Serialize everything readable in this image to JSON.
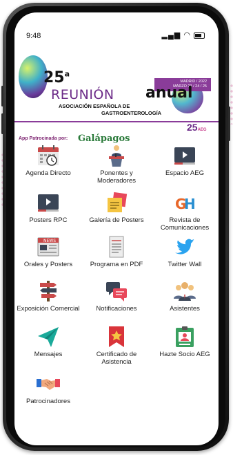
{
  "status": {
    "time": "9:48"
  },
  "banner": {
    "edition": "25",
    "edition_sup": "a",
    "title_word1": "REUNIÓN",
    "title_word2": "anual",
    "dates_line1": "MADRID / 2022",
    "dates_line2": "MARZO 23 / 24 / 25",
    "assoc_line1": "ASOCIACIÓN ESPAÑOLA DE",
    "assoc_line2": "GASTROENTEROLOGÍA",
    "sponsor_prefix": "App Patrocinada por:",
    "sponsor_name": "Galápagos",
    "aeg_number": "25",
    "aeg_mark": "AEG"
  },
  "menu": [
    {
      "label": "Agenda Directo",
      "icon": "calendar-clock-icon"
    },
    {
      "label": "Ponentes y Moderadores",
      "icon": "speaker-podium-icon"
    },
    {
      "label": "Espacio AEG",
      "icon": "video-player-icon"
    },
    {
      "label": "Posters RPC",
      "icon": "video-player-icon"
    },
    {
      "label": "Galería de Posters",
      "icon": "sticky-notes-icon"
    },
    {
      "label": "Revista de Comunicaciones",
      "icon": "gh-journal-icon"
    },
    {
      "label": "Orales y Posters",
      "icon": "newspaper-icon"
    },
    {
      "label": "Programa en PDF",
      "icon": "document-icon"
    },
    {
      "label": "Twitter Wall",
      "icon": "twitter-bird-icon"
    },
    {
      "label": "Exposición Comercial",
      "icon": "signpost-icon"
    },
    {
      "label": "Notificaciones",
      "icon": "chat-bubbles-icon"
    },
    {
      "label": "Asistentes",
      "icon": "people-group-icon"
    },
    {
      "label": "Mensajes",
      "icon": "paper-plane-icon"
    },
    {
      "label": "Certificado de Asistencia",
      "icon": "certificate-star-icon"
    },
    {
      "label": "Hazte Socio AEG",
      "icon": "id-badge-icon"
    },
    {
      "label": "Patrocinadores",
      "icon": "handshake-icon"
    }
  ],
  "colors": {
    "brand_purple": "#8a3c99",
    "accent_green": "#2a7a3a"
  }
}
